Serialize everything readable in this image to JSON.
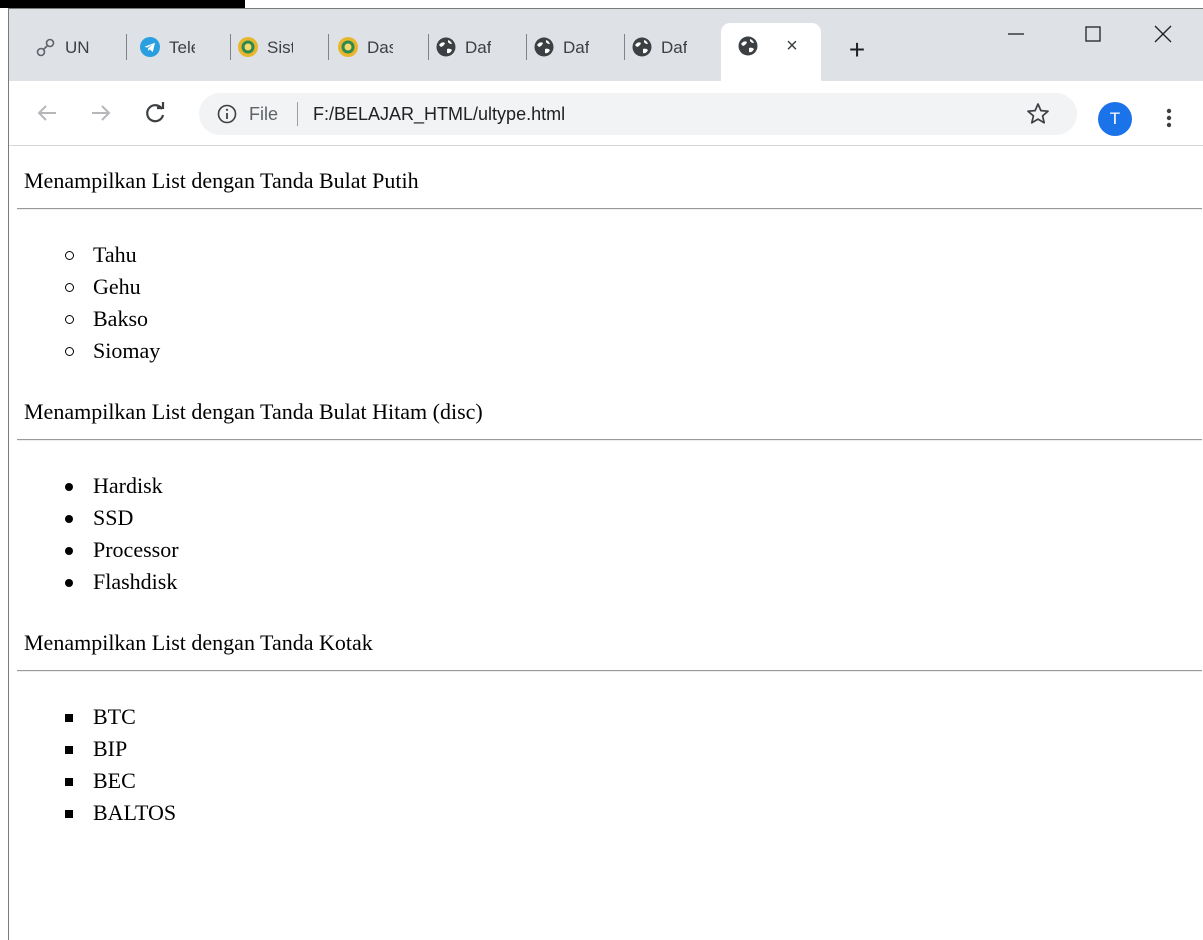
{
  "browser": {
    "tabs": [
      {
        "label": "UN",
        "icon": "link-icon"
      },
      {
        "label": "Tele",
        "icon": "telegram-icon"
      },
      {
        "label": "Sist",
        "icon": "university-logo-icon"
      },
      {
        "label": "Das",
        "icon": "university-logo-icon"
      },
      {
        "label": "Daf",
        "icon": "globe-icon"
      },
      {
        "label": "Daf",
        "icon": "globe-icon"
      },
      {
        "label": "Daf",
        "icon": "globe-icon"
      }
    ],
    "active_tab": {
      "icon": "globe-icon",
      "close": "×"
    },
    "new_tab_label": "+",
    "address": {
      "scheme_label": "File",
      "url": "F:/BELAJAR_HTML/ultype.html"
    },
    "profile_initial": "T",
    "accent_color": "#1a73e8"
  },
  "page": {
    "sections": [
      {
        "heading": "Menampilkan List dengan Tanda Bulat Putih",
        "marker": "circle",
        "items": [
          "Tahu",
          "Gehu",
          "Bakso",
          "Siomay"
        ]
      },
      {
        "heading": "Menampilkan List dengan Tanda Bulat Hitam (disc)",
        "marker": "disc",
        "items": [
          "Hardisk",
          "SSD",
          "Processor",
          "Flashdisk"
        ]
      },
      {
        "heading": "Menampilkan List dengan Tanda Kotak",
        "marker": "square",
        "items": [
          "BTC",
          "BIP",
          "BEC",
          "BALTOS"
        ]
      }
    ]
  }
}
